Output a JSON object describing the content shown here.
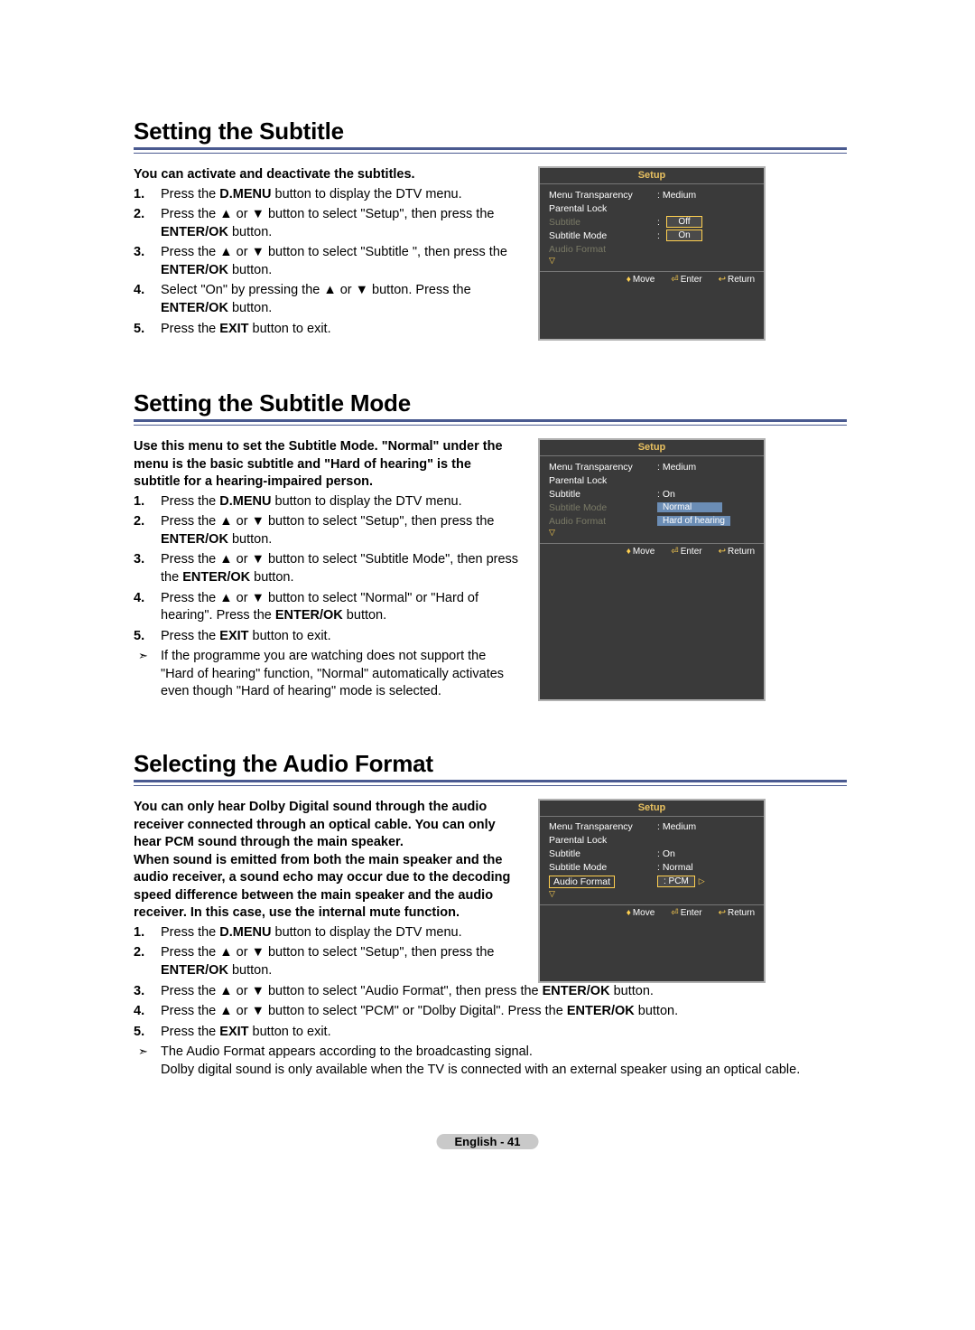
{
  "sections": [
    {
      "title": "Setting the Subtitle",
      "intro": "You can activate and deactivate the subtitles.",
      "steps": [
        [
          [
            "Press the "
          ],
          [
            "b",
            "D.MENU"
          ],
          [
            " button to display the DTV menu."
          ]
        ],
        [
          [
            "Press the ▲ or ▼ button to select \"Setup\", then press the "
          ],
          [
            "b",
            "ENTER/OK"
          ],
          [
            " button."
          ]
        ],
        [
          [
            "Press the ▲ or ▼ button to select \"Subtitle \", then press the "
          ],
          [
            "b",
            "ENTER/OK"
          ],
          [
            " button."
          ]
        ],
        [
          [
            "Select \"On\" by pressing the ▲ or ▼ button. Press the "
          ],
          [
            "b",
            "ENTER/OK"
          ],
          [
            " button."
          ]
        ],
        [
          [
            "Press the "
          ],
          [
            "b",
            "EXIT"
          ],
          [
            " button to exit."
          ]
        ]
      ],
      "notes": [],
      "osd": {
        "title": "Setup",
        "rows": [
          {
            "label": "Menu Transparency",
            "value": ": Medium"
          },
          {
            "label": "Parental Lock",
            "value": ""
          },
          {
            "label": "Subtitle",
            "dim": true,
            "colon": ":",
            "selbox": "Off"
          },
          {
            "label": "Subtitle  Mode",
            "colon": ":",
            "selbox": "On"
          },
          {
            "label": "Audio Format",
            "dim": true,
            "value": ""
          }
        ],
        "footer": [
          [
            "♦",
            "Move"
          ],
          [
            "⏎",
            "Enter"
          ],
          [
            "↩",
            "Return"
          ]
        ]
      }
    },
    {
      "title": "Setting the Subtitle Mode",
      "intro": "Use this menu to set the Subtitle Mode. \"Normal\" under the menu is the basic subtitle and \"Hard of hearing\" is the subtitle for a hearing-impaired person.",
      "steps": [
        [
          [
            "Press the "
          ],
          [
            "b",
            "D.MENU"
          ],
          [
            " button to display the DTV menu."
          ]
        ],
        [
          [
            "Press the ▲ or ▼ button to select \"Setup\", then press the "
          ],
          [
            "b",
            "ENTER/OK"
          ],
          [
            " button."
          ]
        ],
        [
          [
            "Press the ▲ or ▼ button to select \"Subtitle  Mode\", then press the "
          ],
          [
            "b",
            "ENTER/OK"
          ],
          [
            " button."
          ]
        ],
        [
          [
            "Press the ▲ or ▼ button to select \"Normal\" or \"Hard of hearing\". Press the "
          ],
          [
            "b",
            "ENTER/OK"
          ],
          [
            " button."
          ]
        ],
        [
          [
            "Press the "
          ],
          [
            "b",
            "EXIT"
          ],
          [
            " button to exit."
          ]
        ]
      ],
      "notes": [
        [
          [
            "If the programme you are watching does not support the \"Hard of hearing\" function, \"Normal\" automatically activates even though \"Hard of hearing\" mode is selected."
          ]
        ]
      ],
      "osd": {
        "title": "Setup",
        "rows": [
          {
            "label": "Menu Transparency",
            "value": ": Medium"
          },
          {
            "label": "Parental Lock",
            "value": ""
          },
          {
            "label": "Subtitle",
            "value": ": On"
          },
          {
            "label": "Subtitle  Mode",
            "dim": true,
            "optbox": "Normal"
          },
          {
            "label": "Audio Format",
            "dim": true,
            "optbox": "Hard of hearing"
          }
        ],
        "footer": [
          [
            "♦",
            "Move"
          ],
          [
            "⏎",
            "Enter"
          ],
          [
            "↩",
            "Return"
          ]
        ]
      }
    },
    {
      "title": "Selecting the Audio Format",
      "intro": "You can only hear Dolby Digital sound through the audio receiver connected through an optical cable. You can only hear PCM sound through the main speaker.\nWhen sound is emitted from both the main speaker and the audio receiver, a sound echo may occur due to the decoding speed difference between the main speaker and the audio receiver. In this case, use the internal mute function.",
      "steps": [
        [
          [
            "Press the "
          ],
          [
            "b",
            "D.MENU"
          ],
          [
            " button to display the DTV menu."
          ]
        ],
        [
          [
            "Press the ▲ or ▼ button to select \"Setup\", then press the "
          ],
          [
            "b",
            "ENTER/OK"
          ],
          [
            " button."
          ]
        ],
        [
          [
            "Press the ▲ or ▼ button to select \"Audio Format\", then press the "
          ],
          [
            "b",
            "ENTER/OK"
          ],
          [
            " button."
          ]
        ],
        [
          [
            "Press the ▲ or ▼ button to select \"PCM\" or \"Dolby Digital\". Press the "
          ],
          [
            "b",
            "ENTER/OK"
          ],
          [
            " button."
          ]
        ],
        [
          [
            "Press the "
          ],
          [
            "b",
            "EXIT"
          ],
          [
            " button to exit."
          ]
        ]
      ],
      "notes": [
        [
          [
            "The Audio Format appears according to the broadcasting signal.\nDolby digital sound is only available when the TV is connected with an external speaker using an optical cable."
          ]
        ]
      ],
      "osd": {
        "title": "Setup",
        "rows": [
          {
            "label": "Menu Transparency",
            "value": ": Medium"
          },
          {
            "label": "Parental Lock",
            "value": ""
          },
          {
            "label": "Subtitle",
            "value": ": On"
          },
          {
            "label": "Subtitle  Mode",
            "value": ": Normal"
          },
          {
            "label": "Audio Format",
            "hlbox": true,
            "valbox": ": PCM",
            "tri": true
          }
        ],
        "footer": [
          [
            "♦",
            "Move"
          ],
          [
            "⏎",
            "Enter"
          ],
          [
            "↩",
            "Return"
          ]
        ]
      }
    }
  ],
  "page_num": "English - 41"
}
